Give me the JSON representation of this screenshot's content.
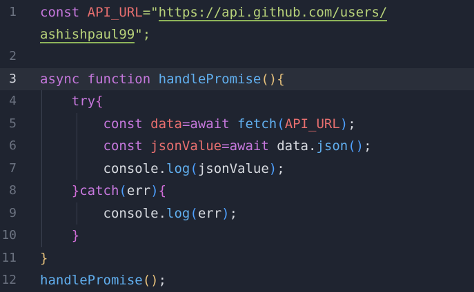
{
  "editor": {
    "lines": [
      {
        "num": "1"
      },
      {
        "num": ""
      },
      {
        "num": "2"
      },
      {
        "num": "3"
      },
      {
        "num": "4"
      },
      {
        "num": "5"
      },
      {
        "num": "6"
      },
      {
        "num": "7"
      },
      {
        "num": "8"
      },
      {
        "num": "9"
      },
      {
        "num": "10"
      },
      {
        "num": "11"
      },
      {
        "num": "12"
      }
    ],
    "tokens": {
      "const": "const",
      "api_url": "API_URL",
      "eq_quote": "=\"",
      "url_part1": "https://api.github.com/users/",
      "url_part2": "ashishpaul99",
      "quote_semi": "\";",
      "async": "async",
      "function": "function",
      "handlePromise": "handlePromise",
      "try": "try",
      "data": "data",
      "await": "await",
      "fetch": "fetch",
      "jsonValue": "jsonValue",
      "json": "json",
      "console": "console",
      "log": "log",
      "catch": "catch",
      "err": "err"
    }
  },
  "colors": {
    "background": "#1f2430",
    "active_line": "#2a2f3a",
    "keyword": "#c678dd",
    "function": "#61afef",
    "string": "#b8d27a",
    "identifier": "#e86f6f",
    "paren_yellow": "#e5c07b",
    "paren_magenta": "#d16ed8",
    "paren_blue": "#4ea0ff"
  }
}
